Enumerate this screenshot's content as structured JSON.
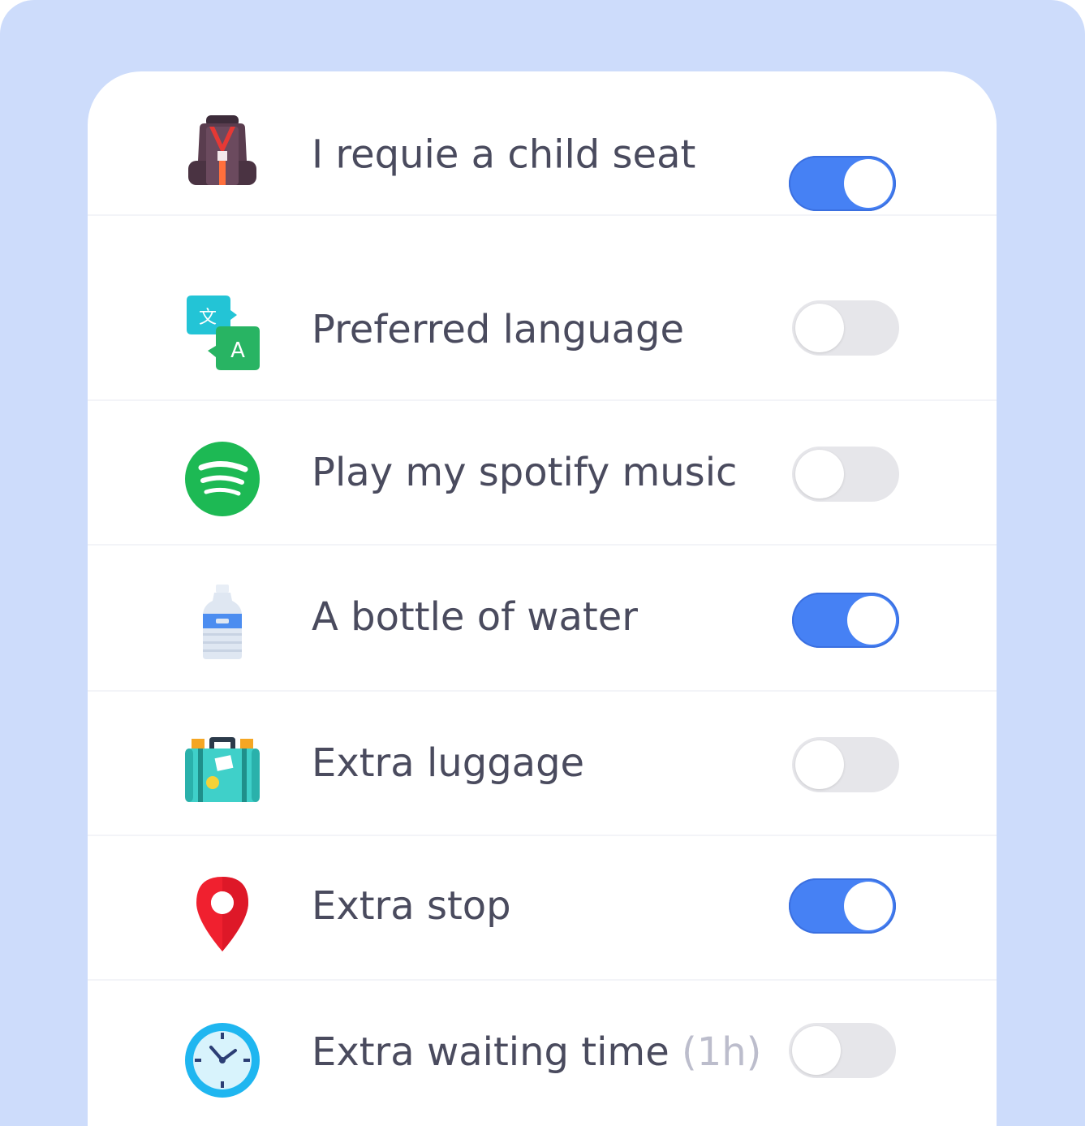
{
  "accent_color": "#4681f4",
  "options": [
    {
      "label": "I requie a child seat",
      "suffix": "",
      "icon": "child-seat-icon",
      "enabled": true
    },
    {
      "label": "Preferred language",
      "suffix": "",
      "icon": "translate-icon",
      "enabled": false
    },
    {
      "label": "Play my spotify music",
      "suffix": "",
      "icon": "spotify-icon",
      "enabled": false
    },
    {
      "label": "A bottle of water",
      "suffix": "",
      "icon": "water-bottle-icon",
      "enabled": true
    },
    {
      "label": "Extra luggage",
      "suffix": "",
      "icon": "luggage-icon",
      "enabled": false
    },
    {
      "label": "Extra stop",
      "suffix": "",
      "icon": "map-pin-icon",
      "enabled": true
    },
    {
      "label": "Extra waiting time",
      "suffix": "(1h)",
      "icon": "clock-icon",
      "enabled": false
    }
  ]
}
